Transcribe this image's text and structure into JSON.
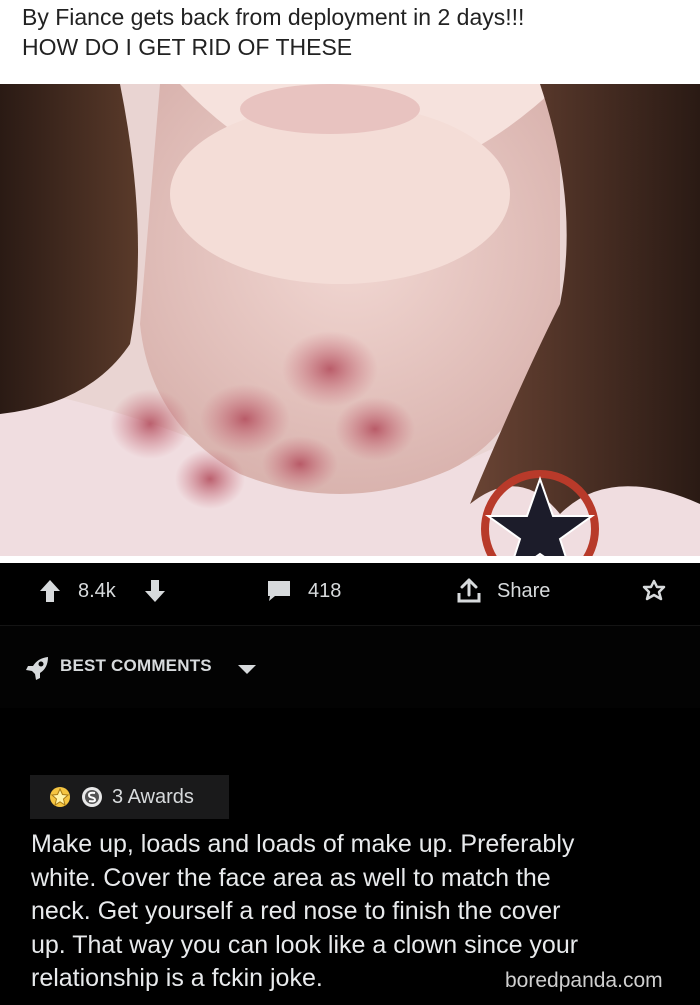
{
  "post": {
    "title_line1": "By Fiance gets back from deployment in 2 days!!!",
    "title_line2": "HOW DO I GET RID OF THESE"
  },
  "actions": {
    "votes": "8.4k",
    "comments": "418",
    "share_label": "Share"
  },
  "sort": {
    "label": "BEST COMMENTS"
  },
  "comment": {
    "awards_label": "3 Awards",
    "lines": [
      "Make up, loads and loads of make up. Preferably",
      "white.  Cover the face area as well to match the",
      "neck. Get yourself a red nose to finish the cover",
      "up. That way you can look like a clown since your",
      "relationship is a fckin joke."
    ]
  },
  "watermark": "boredpanda.com",
  "colors": {
    "text_light": "#d7dadc",
    "award_box_bg": "#1a1a1b",
    "award_gold": "#f5c542"
  },
  "icons": {
    "upvote": "arrow-up-icon",
    "downvote": "arrow-down-icon",
    "comments": "chat-bubble-icon",
    "share": "share-icon",
    "award": "award-icon",
    "sort": "rocket-icon"
  }
}
